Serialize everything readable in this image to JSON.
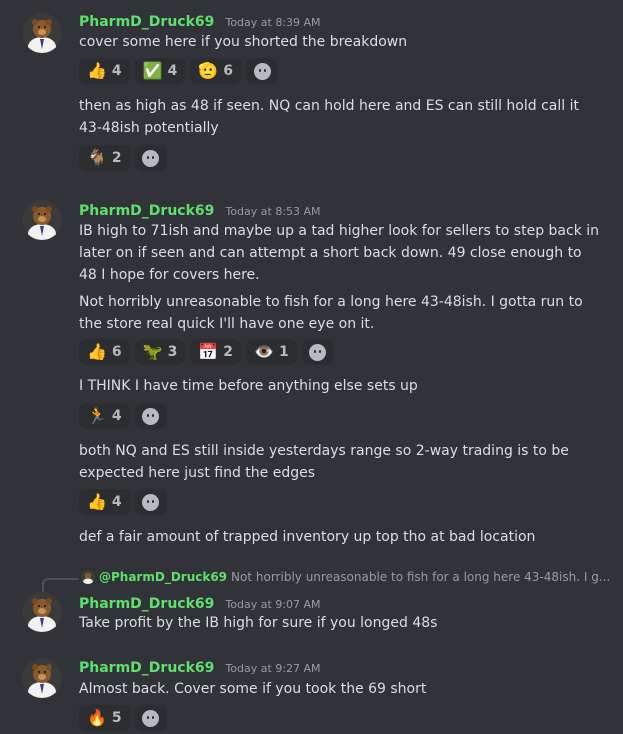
{
  "messages": [
    {
      "user": "PharmD_Druck69",
      "time": "Today at 8:39 AM",
      "lines": [
        "cover some here if you shorted the breakdown"
      ],
      "reactions": [
        {
          "emoji": "👍",
          "icon": "thumbs-up",
          "count": "4"
        },
        {
          "emoji": "✅",
          "icon": "check-mark",
          "count": "4"
        },
        {
          "emoji": "🫡",
          "icon": "saluting-face",
          "count": "6"
        }
      ],
      "lines2": [
        "then as high as 48 if seen. NQ can hold here and ES can still hold call it",
        "43-48ish potentially"
      ],
      "reactions2": [
        {
          "emoji": "🐐",
          "icon": "goat",
          "count": "2"
        }
      ]
    },
    {
      "user": "PharmD_Druck69",
      "time": "Today at 8:53 AM",
      "lines": [
        "IB high to 71ish and maybe up a tad higher look for sellers to step back in",
        "later on if seen and can attempt a short back down. 49 close enough to",
        "48 I hope for covers here.",
        "Not horribly unreasonable to fish for a long here 43-48ish. I gotta run to",
        "the store real quick I'll have one eye on it."
      ],
      "reactions": [
        {
          "emoji": "👍",
          "icon": "thumbs-up",
          "count": "6"
        },
        {
          "emoji": "🦖",
          "icon": "t-rex",
          "count": "3"
        },
        {
          "emoji": "📅",
          "icon": "calendar",
          "count": "2"
        },
        {
          "emoji": "👁️",
          "icon": "eye",
          "count": "1"
        }
      ],
      "followups": [
        {
          "text": "I THINK I have time before anything else sets up",
          "reactions": [
            {
              "emoji": "🏃",
              "icon": "runner",
              "count": "4"
            }
          ]
        },
        {
          "text1": "both NQ and ES still inside yesterdays range so 2-way trading is to be",
          "text2": "expected here just find the edges",
          "reactions": [
            {
              "emoji": "👍",
              "icon": "thumbs-up",
              "count": "4"
            }
          ]
        },
        {
          "text": "def a fair amount of trapped inventory up top tho at bad location"
        }
      ]
    },
    {
      "reply_to": {
        "user": "@PharmD_Druck69",
        "text": "Not horribly unreasonable to fish for a long here 43-48ish. I g..."
      },
      "user": "PharmD_Druck69",
      "time": "Today at 9:07 AM",
      "lines": [
        "Take profit by the IB high for sure if you longed 48s"
      ]
    },
    {
      "user": "PharmD_Druck69",
      "time": "Today at 9:27 AM",
      "lines": [
        "Almost back. Cover some if you took the 69 short"
      ],
      "reactions": [
        {
          "emoji": "🔥",
          "icon": "fire",
          "count": "5"
        }
      ]
    }
  ],
  "colors": {
    "background": "#313338",
    "username": "#5ee06c",
    "text": "#dbdee1",
    "timestamp": "#949ba4",
    "reaction_bg": "#2b2d31"
  }
}
